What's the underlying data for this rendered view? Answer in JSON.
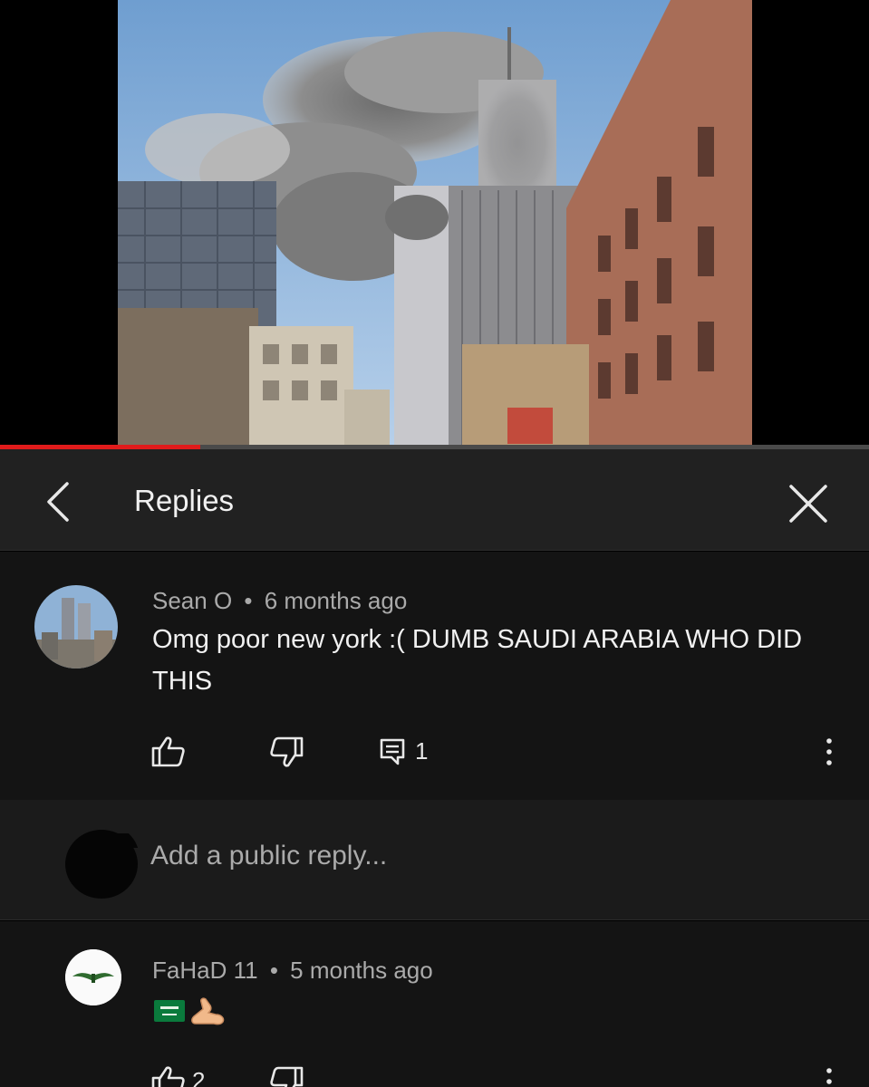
{
  "video": {
    "progress": 0.23,
    "accent_color": "#e01b1b"
  },
  "header": {
    "back_icon": "chevron-left-icon",
    "title": "Replies",
    "close_icon": "close-icon"
  },
  "comment": {
    "author": "Sean O",
    "separator": "•",
    "time": "6 months ago",
    "text": "Omg poor new york :( DUMB SAUDI ARABIA WHO DID THIS",
    "reply_count": "1",
    "icons": [
      "thumbs-up-icon",
      "thumbs-down-icon",
      "comment-icon",
      "more-vertical-icon"
    ]
  },
  "reply_box": {
    "placeholder": "Add a public reply..."
  },
  "replies": [
    {
      "author": "FaHaD 11",
      "separator": "•",
      "time": "5 months ago",
      "emoji": [
        "saudi-flag-emoji",
        "flexed-biceps-emoji"
      ],
      "like_count": "2"
    }
  ]
}
